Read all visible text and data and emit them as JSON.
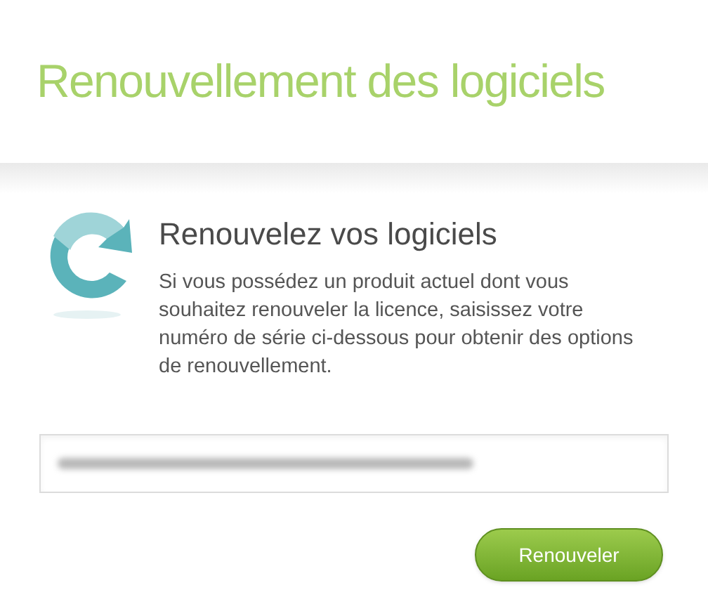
{
  "header": {
    "title": "Renouvellement des logiciels"
  },
  "intro": {
    "heading": "Renouvelez vos logiciels",
    "text": "Si vous possédez un produit actuel dont vous souhaitez renouveler la licence, saisissez votre numéro de série ci-dessous pour obtenir des options de renouvellement."
  },
  "serial_field": {
    "blurred": true
  },
  "button": {
    "label": "Renouveler"
  }
}
